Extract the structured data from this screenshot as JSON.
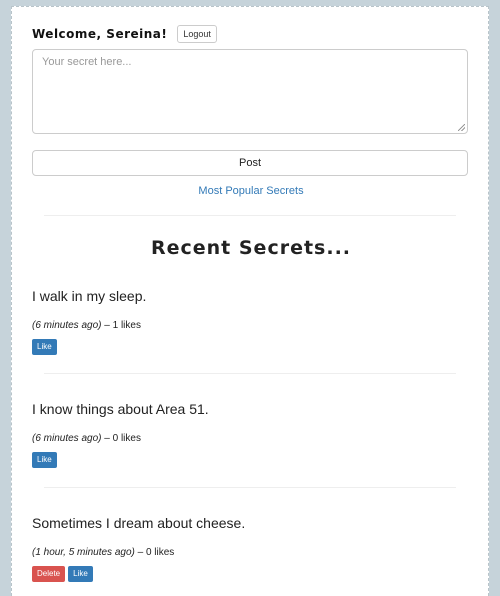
{
  "header": {
    "welcome": "Welcome, Sereina!",
    "logout_label": "Logout"
  },
  "form": {
    "placeholder": "Your secret here...",
    "post_label": "Post"
  },
  "nav": {
    "popular_link": "Most Popular Secrets"
  },
  "recent": {
    "title": "Recent Secrets...",
    "secrets": [
      {
        "text": "I walk in my sleep.",
        "time": "(6 minutes ago)",
        "likes": "– 1 likes",
        "like_label": "Like"
      },
      {
        "text": "I know things about Area 51.",
        "time": "(6 minutes ago)",
        "likes": "– 0 likes",
        "like_label": "Like"
      },
      {
        "text": "Sometimes I dream about cheese.",
        "time": "(1 hour, 5 minutes ago)",
        "likes": "– 0 likes",
        "like_label": "Like",
        "delete_label": "Delete"
      }
    ]
  },
  "colors": {
    "link": "#337ab7",
    "like_button": "#337ab7",
    "delete_button": "#d9534f",
    "page_background": "#c6d3da"
  }
}
